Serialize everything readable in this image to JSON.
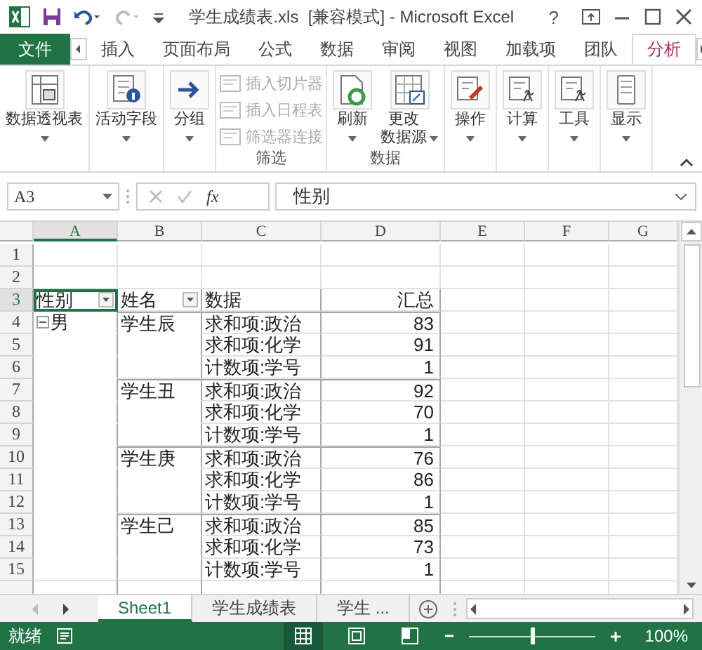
{
  "title_bar": {
    "title": "学生成绩表.xls  [兼容模式] - Microsoft Excel",
    "help": "?",
    "redo_disabled": true
  },
  "ribbon_tabs": [
    {
      "label": "文件",
      "kind": "file",
      "selected": false
    },
    {
      "label": "插入",
      "kind": "tab",
      "selected": false
    },
    {
      "label": "页面布局",
      "kind": "tab",
      "selected": false
    },
    {
      "label": "公式",
      "kind": "tab",
      "selected": false
    },
    {
      "label": "数据",
      "kind": "tab",
      "selected": false
    },
    {
      "label": "审阅",
      "kind": "tab",
      "selected": false
    },
    {
      "label": "视图",
      "kind": "tab",
      "selected": false
    },
    {
      "label": "加载项",
      "kind": "tab",
      "selected": false
    },
    {
      "label": "团队",
      "kind": "tab",
      "selected": false
    },
    {
      "label": "分析",
      "kind": "tab",
      "selected": true
    }
  ],
  "ribbon_groups": [
    {
      "buttons": [
        {
          "label": "数据透视表",
          "kind": "large",
          "dropdown": true,
          "disabled": false
        }
      ]
    },
    {
      "buttons": [
        {
          "label": "活动字段",
          "kind": "large",
          "dropdown": true,
          "disabled": false
        }
      ]
    },
    {
      "buttons": [
        {
          "label": "分组",
          "kind": "large",
          "dropdown": true,
          "disabled": false
        }
      ]
    },
    {
      "caption": "筛选",
      "buttons": [
        {
          "label": "插入切片器",
          "kind": "small",
          "disabled": true
        },
        {
          "label": "插入日程表",
          "kind": "small",
          "disabled": true
        },
        {
          "label": "筛选器连接",
          "kind": "small",
          "disabled": true
        }
      ]
    },
    {
      "caption": "数据",
      "buttons": [
        {
          "label": "刷新",
          "kind": "large",
          "dropdown": true,
          "disabled": false
        },
        {
          "label": "更改数据源",
          "kind": "large",
          "dropdown": true,
          "disabled": false
        }
      ]
    },
    {
      "buttons": [
        {
          "label": "操作",
          "kind": "large",
          "dropdown": true,
          "disabled": false
        }
      ]
    },
    {
      "buttons": [
        {
          "label": "计算",
          "kind": "large",
          "dropdown": true,
          "disabled": false
        }
      ]
    },
    {
      "buttons": [
        {
          "label": "工具",
          "kind": "large",
          "dropdown": true,
          "disabled": false
        }
      ]
    },
    {
      "buttons": [
        {
          "label": "显示",
          "kind": "large",
          "dropdown": true,
          "disabled": false
        }
      ]
    }
  ],
  "formula_bar": {
    "name_box": "A3",
    "function_label": "fx",
    "value": "性别"
  },
  "columns": [
    {
      "label": "A",
      "selected": true
    },
    {
      "label": "B",
      "selected": false
    },
    {
      "label": "C",
      "selected": false
    },
    {
      "label": "D",
      "selected": false
    },
    {
      "label": "E",
      "selected": false
    },
    {
      "label": "F",
      "selected": false
    },
    {
      "label": "G",
      "selected": false
    }
  ],
  "rows": [
    {
      "number": "1",
      "kind": "blank",
      "selected": false
    },
    {
      "number": "2",
      "kind": "blank",
      "selected": false
    },
    {
      "number": "3",
      "kind": "header",
      "selected": true,
      "gender": "性别",
      "name": "姓名",
      "field": "数据",
      "total": "汇总"
    },
    {
      "number": "4",
      "kind": "data",
      "selected": false,
      "gender": "男",
      "expanded": true,
      "name": "学生辰",
      "field": "求和项:政治",
      "total": "83"
    },
    {
      "number": "5",
      "kind": "data",
      "selected": false,
      "field": "求和项:化学",
      "total": "91"
    },
    {
      "number": "6",
      "kind": "data",
      "selected": false,
      "field": "计数项:学号",
      "total": "1"
    },
    {
      "number": "7",
      "kind": "data",
      "selected": false,
      "name": "学生丑",
      "field": "求和项:政治",
      "total": "92"
    },
    {
      "number": "8",
      "kind": "data",
      "selected": false,
      "field": "求和项:化学",
      "total": "70"
    },
    {
      "number": "9",
      "kind": "data",
      "selected": false,
      "field": "计数项:学号",
      "total": "1"
    },
    {
      "number": "10",
      "kind": "data",
      "selected": false,
      "name": "学生庚",
      "field": "求和项:政治",
      "total": "76"
    },
    {
      "number": "11",
      "kind": "data",
      "selected": false,
      "field": "求和项:化学",
      "total": "86"
    },
    {
      "number": "12",
      "kind": "data",
      "selected": false,
      "field": "计数项:学号",
      "total": "1"
    },
    {
      "number": "13",
      "kind": "data",
      "selected": false,
      "name": "学生己",
      "field": "求和项:政治",
      "total": "85"
    },
    {
      "number": "14",
      "kind": "data",
      "selected": false,
      "field": "求和项:化学",
      "total": "73"
    },
    {
      "number": "15",
      "kind": "data",
      "selected": false,
      "field": "计数项:学号",
      "total": "1"
    }
  ],
  "sheet_tabs": [
    {
      "label": "Sheet1",
      "selected": true
    },
    {
      "label": "学生成绩表",
      "selected": false
    },
    {
      "label": "学生 ...",
      "selected": false
    }
  ],
  "status_bar": {
    "status": "就绪",
    "views": [
      {
        "selected": true
      },
      {
        "selected": false
      },
      {
        "selected": false
      }
    ],
    "zoom": "100%",
    "level": 0.5
  }
}
